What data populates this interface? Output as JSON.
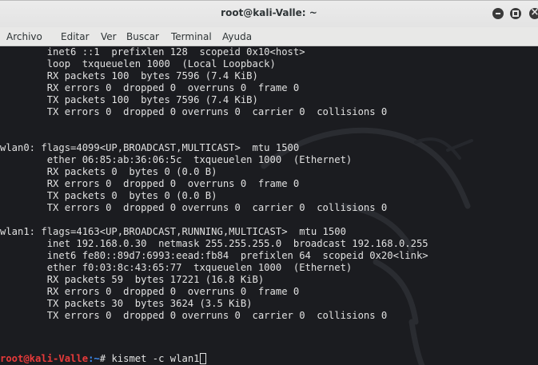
{
  "window": {
    "title": "root@kali-Valle: ~"
  },
  "menubar": {
    "items": [
      "Archivo",
      "Editar",
      "Ver",
      "Buscar",
      "Terminal",
      "Ayuda"
    ]
  },
  "terminal": {
    "lines": [
      "        inet6 ::1  prefixlen 128  scopeid 0x10<host>",
      "        loop  txqueuelen 1000  (Local Loopback)",
      "        RX packets 100  bytes 7596 (7.4 KiB)",
      "        RX errors 0  dropped 0  overruns 0  frame 0",
      "        TX packets 100  bytes 7596 (7.4 KiB)",
      "        TX errors 0  dropped 0 overruns 0  carrier 0  collisions 0",
      "",
      "wlan0: flags=4099<UP,BROADCAST,MULTICAST>  mtu 1500",
      "        ether 06:85:ab:36:06:5c  txqueuelen 1000  (Ethernet)",
      "        RX packets 0  bytes 0 (0.0 B)",
      "        RX errors 0  dropped 0  overruns 0  frame 0",
      "        TX packets 0  bytes 0 (0.0 B)",
      "        TX errors 0  dropped 0 overruns 0  carrier 0  collisions 0",
      "",
      "wlan1: flags=4163<UP,BROADCAST,RUNNING,MULTICAST>  mtu 1500",
      "        inet 192.168.0.30  netmask 255.255.255.0  broadcast 192.168.0.255",
      "        inet6 fe80::89d7:6993:eead:fb84  prefixlen 64  scopeid 0x20<link>",
      "        ether f0:03:8c:43:65:77  txqueuelen 1000  (Ethernet)",
      "        RX packets 59  bytes 17221 (16.8 KiB)",
      "        RX errors 0  dropped 0  overruns 0  frame 0",
      "        TX packets 30  bytes 3624 (3.5 KiB)",
      "        TX errors 0  dropped 0 overruns 0  carrier 0  collisions 0",
      ""
    ],
    "prompt": {
      "user_host": "root@kali-Valle",
      "path": ":~",
      "symbol": "# ",
      "command": "kismet -c wlan1"
    }
  },
  "colors": {
    "terminal_bg": "#1b1c20",
    "text": "#e1e1e1",
    "prompt_user": "#e83a3a",
    "prompt_path": "#3e8ef5"
  }
}
